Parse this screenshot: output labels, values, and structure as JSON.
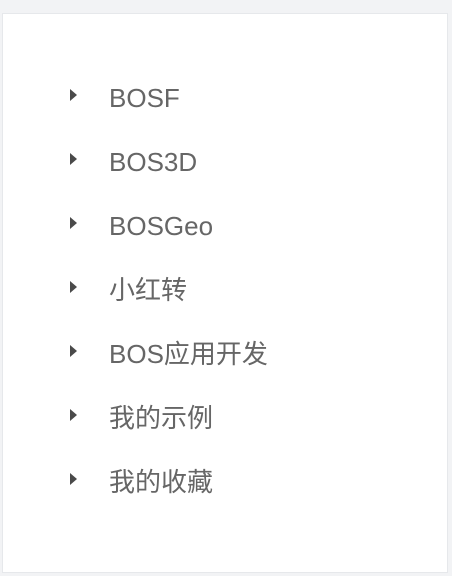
{
  "tree": {
    "items": [
      {
        "label": "BOSF",
        "icon": "caret-right-icon"
      },
      {
        "label": "BOS3D",
        "icon": "caret-right-icon"
      },
      {
        "label": "BOSGeo",
        "icon": "caret-right-icon"
      },
      {
        "label": "小红转",
        "icon": "caret-right-icon"
      },
      {
        "label": "BOS应用开发",
        "icon": "caret-right-icon"
      },
      {
        "label": "我的示例",
        "icon": "caret-right-icon"
      },
      {
        "label": "我的收藏",
        "icon": "caret-right-icon"
      }
    ]
  },
  "colors": {
    "page_background": "#f2f3f5",
    "panel_background": "#ffffff",
    "label_text": "#666666",
    "caret": "#4a4a4a"
  }
}
